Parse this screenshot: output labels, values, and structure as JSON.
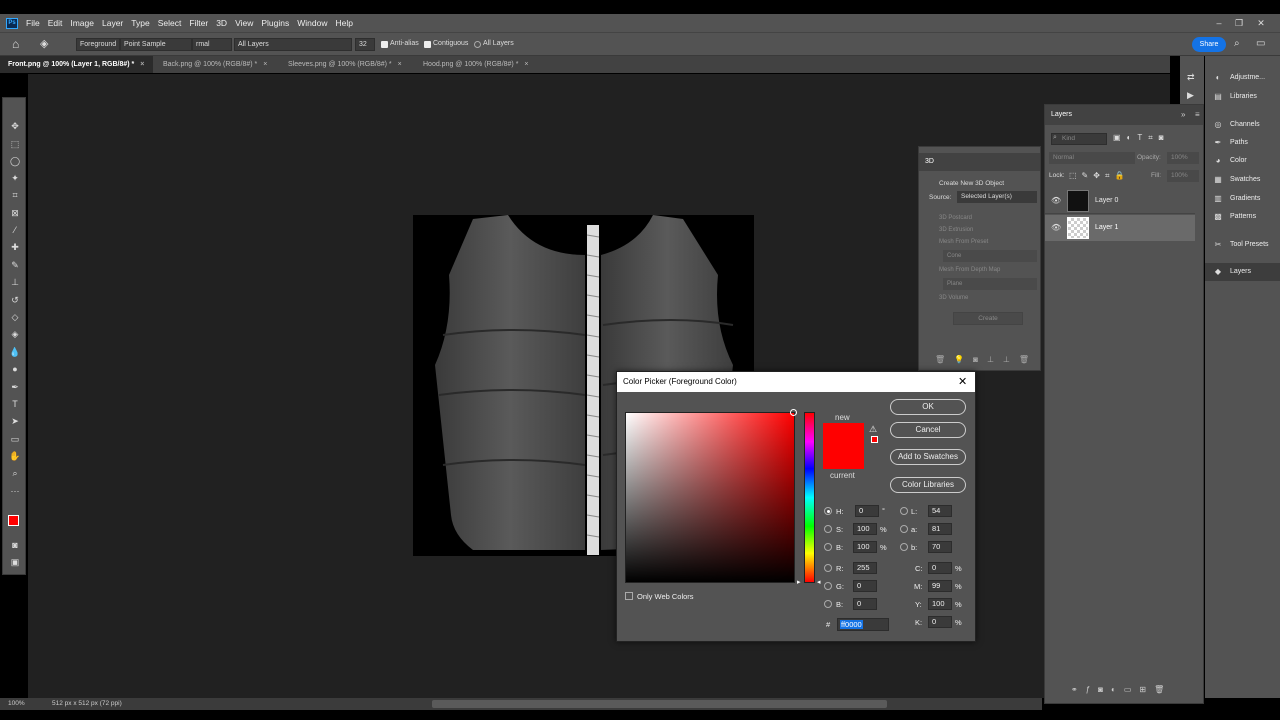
{
  "menu": {
    "logo": "Ps",
    "items": [
      "File",
      "Edit",
      "Image",
      "Layer",
      "Type",
      "Select",
      "Filter",
      "3D",
      "View",
      "Plugins",
      "Window",
      "Help"
    ]
  },
  "options": {
    "sample_source": "Foreground",
    "sample_mode": "Point Sample",
    "blend_mode_fragment": "rmal",
    "sample_layers": "All Layers",
    "tolerance": "32",
    "antialias_label": "Anti-alias",
    "contiguous_label": "Contiguous",
    "all_layers_label": "All Layers",
    "share_label": "Share"
  },
  "tabs": [
    {
      "label": "Front.png @ 100% (Layer 1, RGB/8#) *",
      "active": true
    },
    {
      "label": "Back.png @ 100% (RGB/8#) *",
      "active": false
    },
    {
      "label": "Sleeves.png @ 100% (RGB/8#) *",
      "active": false
    },
    {
      "label": "Hood.png @ 100% (RGB/8#) *",
      "active": false
    }
  ],
  "status": {
    "zoom": "100%",
    "doc_size": "512 px x 512 px (72 ppi)"
  },
  "right_panels": [
    {
      "label": "Adjustme...",
      "icon": "adjustments-icon"
    },
    {
      "label": "Libraries",
      "icon": "libraries-icon"
    },
    {
      "label": "Channels",
      "icon": "channels-icon"
    },
    {
      "label": "Paths",
      "icon": "paths-icon"
    },
    {
      "label": "Color",
      "icon": "color-icon"
    },
    {
      "label": "Swatches",
      "icon": "swatches-icon"
    },
    {
      "label": "Gradients",
      "icon": "gradients-icon"
    },
    {
      "label": "Patterns",
      "icon": "patterns-icon"
    },
    {
      "label": "Tool Presets",
      "icon": "tool-presets-icon"
    },
    {
      "label": "Layers",
      "icon": "layers-icon"
    }
  ],
  "layers_panel": {
    "title": "Layers",
    "kind_placeholder": "Kind",
    "blend_mode": "Normal",
    "opacity_label": "Opacity:",
    "opacity_value": "100%",
    "lock_label": "Lock:",
    "fill_label": "Fill:",
    "fill_value": "100%",
    "layers": [
      {
        "name": "Layer 0",
        "selected": false
      },
      {
        "name": "Layer 1",
        "selected": true
      }
    ]
  },
  "panel_3d": {
    "title": "3D",
    "create_new": "Create New 3D Object",
    "source_label": "Source:",
    "source_value": "Selected Layer(s)",
    "options": [
      "3D Postcard",
      "3D Extrusion",
      "Mesh From Preset"
    ],
    "preset_value": "Cone",
    "depth_map": "Mesh From Depth Map",
    "depth_value": "Plane",
    "volume": "3D Volume",
    "create_button": "Create"
  },
  "color_picker": {
    "title": "Color Picker (Foreground Color)",
    "new_label": "new",
    "current_label": "current",
    "buttons": {
      "ok": "OK",
      "cancel": "Cancel",
      "add_swatches": "Add to Swatches",
      "color_libraries": "Color Libraries"
    },
    "only_web_colors": "Only Web Colors",
    "hsb": {
      "h": "0",
      "s": "100",
      "b": "100",
      "h_unit": "°",
      "s_unit": "%",
      "b_unit": "%"
    },
    "rgb": {
      "r": "255",
      "g": "0",
      "b": "0"
    },
    "lab": {
      "l": "54",
      "a": "81",
      "b": "70"
    },
    "cmyk": {
      "c": "0",
      "m": "99",
      "y": "100",
      "k": "0",
      "unit": "%"
    },
    "hex": "ff0000",
    "labels": {
      "h": "H:",
      "s": "S:",
      "b": "B:",
      "r": "R:",
      "g": "G:",
      "b2": "B:",
      "l": "L:",
      "a": "a:",
      "lb": "b:",
      "c": "C:",
      "m": "M:",
      "y": "Y:",
      "k": "K:",
      "hash": "#"
    },
    "colors": {
      "new": "#ff0000",
      "current": "#ff0000",
      "hue": "#ff0000"
    }
  }
}
